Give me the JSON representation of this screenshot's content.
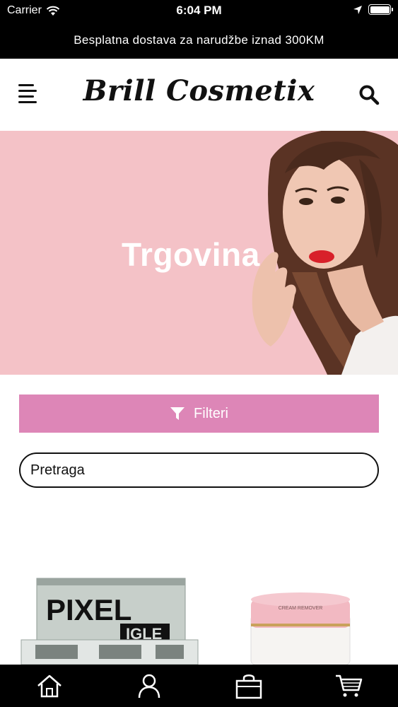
{
  "status_bar": {
    "carrier": "Carrier",
    "time": "6:04 PM"
  },
  "promo_banner": {
    "text": "Besplatna dostava za narudžbe iznad 300KM"
  },
  "header": {
    "logo": "Brill Cosmetix"
  },
  "hero": {
    "title": "Trgovina",
    "background_color": "#f4c2c7"
  },
  "filters": {
    "label": "Filteri",
    "color": "#dd86b7"
  },
  "search": {
    "placeholder": "Pretraga"
  },
  "products": [
    {
      "package_brand": "PIXEL",
      "package_sub": "IGLE"
    },
    {
      "label": "CREAM REMOVER"
    }
  ],
  "tab_bar": {
    "items": [
      "home-icon",
      "account-icon",
      "shop-bag-icon",
      "cart-icon"
    ]
  }
}
